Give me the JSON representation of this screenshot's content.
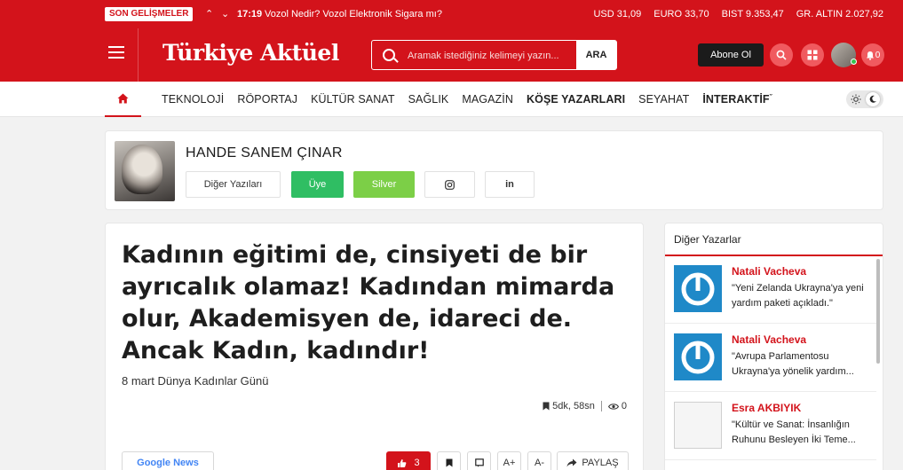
{
  "ticker": {
    "badge": "SON GELİŞMELER",
    "time": "17:19",
    "headline": "Vozol Nedir? Vozol Elektronik Sigara mı?",
    "markets": [
      {
        "label": "USD 31,09"
      },
      {
        "label": "EURO 33,70"
      },
      {
        "label": "BIST 9.353,47"
      },
      {
        "label": "GR. ALTIN 2.027,92"
      }
    ]
  },
  "header": {
    "logo": "Türkiye Aktüel",
    "search_placeholder": "Aramak istediğiniz kelimeyi yazın...",
    "search_button": "ARA",
    "subscribe": "Abone Ol",
    "notif_count": "0"
  },
  "nav": {
    "items": [
      {
        "label": "TEKNOLOJİ",
        "bold": false
      },
      {
        "label": "RÖPORTAJ",
        "bold": false
      },
      {
        "label": "KÜLTÜR SANAT",
        "bold": false
      },
      {
        "label": "SAĞLIK",
        "bold": false
      },
      {
        "label": "MAGAZİN",
        "bold": false
      },
      {
        "label": "KÖŞE YAZARLARI",
        "bold": true
      },
      {
        "label": "SEYAHAT",
        "bold": false
      },
      {
        "label": "İNTERAKTİF",
        "bold": true
      }
    ]
  },
  "author": {
    "name": "HANDE SANEM ÇINAR",
    "buttons": {
      "other": "Diğer Yazıları",
      "member": "Üye",
      "silver": "Silver"
    }
  },
  "article": {
    "title": "Kadının eğitimi de, cinsiyeti de bir ayrıcalık olamaz! Kadından mimarda olur, Akademisyen de, idareci de. Ancak Kadın, kadındır!",
    "subtitle": "8 mart Dünya Kadınlar Günü",
    "read_time": "5dk, 58sn",
    "views": "0",
    "google_news": "Google News",
    "likes": "3",
    "font_up": "A+",
    "font_down": "A-",
    "share": "PAYLAŞ"
  },
  "sidebar": {
    "title": "Diğer Yazarlar",
    "items": [
      {
        "author": "Natali Vacheva",
        "text": "\"Yeni Zelanda Ukrayna'ya yeni yardım paketi açıkladı.\""
      },
      {
        "author": "Natali Vacheva",
        "text": "\"Avrupa Parlamentosu Ukrayna'ya yönelik yardım..."
      },
      {
        "author": "Esra AKBIYIK",
        "text": "\"Kültür ve Sanat: İnsanlığın Ruhunu Besleyen İki Teme..."
      }
    ]
  },
  "colors": {
    "brand": "#d3131b",
    "member_green": "#2fbe63",
    "silver_green": "#7ccf47",
    "thumb_blue": "#1f89c8"
  }
}
